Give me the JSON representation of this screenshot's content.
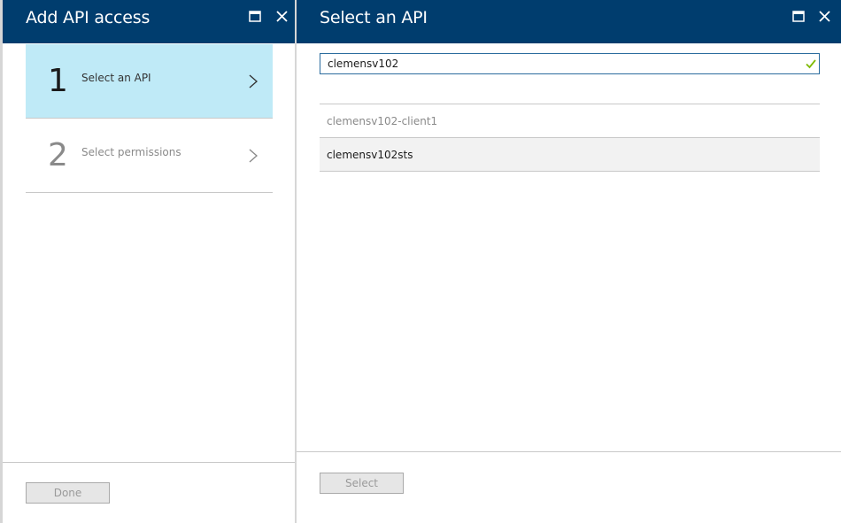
{
  "left_blade": {
    "title": "Add API access",
    "maximize_icon": "maximize-icon",
    "close_icon": "close-icon",
    "steps": [
      {
        "number": "1",
        "label": "Select an API",
        "state": "active"
      },
      {
        "number": "2",
        "label": "Select permissions",
        "state": "inactive"
      }
    ],
    "done_label": "Done"
  },
  "right_blade": {
    "title": "Select an API",
    "maximize_icon": "maximize-icon",
    "close_icon": "close-icon",
    "search": {
      "value": "clemensv102",
      "valid_icon": "checkmark-icon"
    },
    "results": [
      {
        "label": "clemensv102-client1",
        "state": "disabled"
      },
      {
        "label": "clemensv102sts",
        "state": "selected"
      }
    ],
    "select_label": "Select"
  },
  "colors": {
    "header_bg": "#003d6e",
    "active_step_bg": "#bfeaf7",
    "check_green": "#7fba00"
  }
}
